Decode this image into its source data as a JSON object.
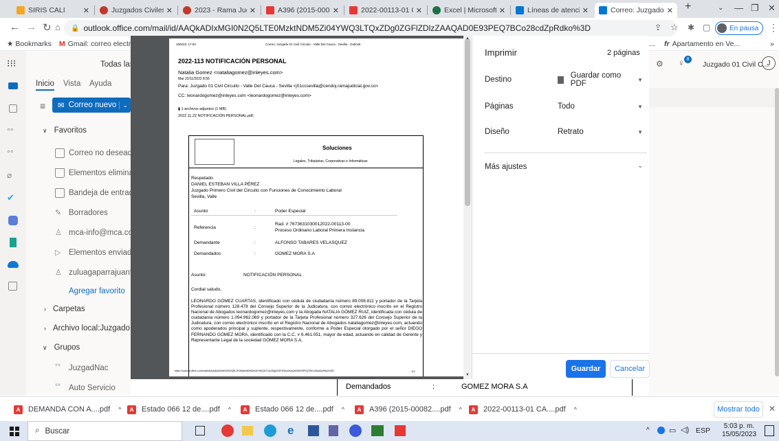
{
  "tabs": [
    {
      "title": "SIRIS CALI",
      "color": "#f5a623"
    },
    {
      "title": "Juzgados Civiles de",
      "color": "#c0392b"
    },
    {
      "title": "2023 - Rama Judic",
      "color": "#c0392b"
    },
    {
      "title": "A396 (2015-00082",
      "color": "#e53935"
    },
    {
      "title": "2022-00113-01 CA",
      "color": "#e53935"
    },
    {
      "title": "Excel | Microsoft 3",
      "color": "#1e7145"
    },
    {
      "title": "Líneas de atención",
      "color": "#0078d4"
    },
    {
      "title": "Correo: Juzgado 01",
      "color": "#0078d4"
    }
  ],
  "browser": {
    "url": "outlook.office.com/mail/id/AAQkADIxMGI0N2Q5LTE0MzktNDM5Zi04YWQ3LTQxZDg0ZGFlZDlzZAAQAD0E93PEQ7BCo28cdZpRdko%3D",
    "bookmarks_label": "Bookmarks",
    "gmail_bookmark": "Gmail: correo electr...",
    "apartamento_bookmark": "Apartamento en Ve...",
    "profile_status": "En pausa",
    "more_bookmarks": "»"
  },
  "outlook": {
    "todas": "Todas las",
    "tabs": [
      "Inicio",
      "Vista",
      "Ayuda"
    ],
    "new_mail": "Correo nuevo",
    "favoritos": "Favoritos",
    "folders": [
      "Correo no deseado",
      "Elementos eliminado",
      "Bandeja de entrada",
      "Borradores",
      "mca-info@mca.com.",
      "Elementos enviados",
      "zuluagaparrajuanfeli"
    ],
    "add_favorite": "Agregar favorito",
    "carpetas": "Carpetas",
    "archivo": "Archivo local:Juzgado 01",
    "grupos": "Grupos",
    "groups": [
      "JuzgadNac",
      "Auto Servicio"
    ],
    "account": "Juzgado 01 Civil C...",
    "account_initial": "J",
    "notif_count": "8",
    "bg_demandados": "Demandados",
    "bg_colon": ":",
    "bg_gomez": "GOMEZ MORA S.A"
  },
  "print": {
    "title": "Imprimir",
    "pages": "2 páginas",
    "destino_label": "Destino",
    "destino_value": "Guardar como PDF",
    "paginas_label": "Páginas",
    "paginas_value": "Todo",
    "diseno_label": "Diseño",
    "diseno_value": "Retrato",
    "mas_ajustes": "Más ajustes",
    "save": "Guardar",
    "cancel": "Cancelar"
  },
  "doc": {
    "header_date": "15/5/23, 17:03",
    "header_title": "Correo: Juzgado 01 Civil Circuito - Valle Del Cauca - Sevilla - Outlook",
    "subject": "2022-113 NOTIFICACIÓN PERSONAL",
    "from": "Natalia Gomez <nataliagomez@inleyes.com>",
    "date": "Mar 22/11/2022 8:55",
    "to": "Para: Juzgado 01 Civil Circuito - Valle Del Cauca - Sevilla <j01ccsevilla@cendoj.ramajudicial.gov.co>",
    "cc": "CC: leonardogomez@inleyes.com <leonardogomez@inleyes.com>",
    "attachments": "1 archivos adjuntos (1 MB)",
    "attachment_name": "2022.11.22 NOTIFICACIÓN PERSONAL.pdf;",
    "company": "Soluciones",
    "company_sub": "Legales, Tributarias, Corporativas e Informáticas",
    "respetado": "Respetado",
    "judge_name": "DANIEL ESTEBAN VILLA PÉREZ",
    "court": "Juzgado Primero Civil del Circuito con Funciones de Conocimiento Laboral",
    "city": "Sevilla, Valle",
    "rows": [
      {
        "k": "Asunto",
        "v": "Poder Especial",
        "v2": ""
      },
      {
        "k": "Referencia",
        "v": "Rad. # 7673631030012022-00113-00",
        "v2": "Proceso Ordinario Laboral Primera Instancia"
      },
      {
        "k": "Demandante",
        "v": "ALFONSO TABARES VELASQUEZ",
        "v2": ""
      },
      {
        "k": "Demandados",
        "v": "GOMEZ MORA S.A",
        "v2": ""
      }
    ],
    "colon": ":",
    "asunto_label": "Asunto:",
    "asunto_value": "NOTIFICACIÓN PERSONAL",
    "greeting": "Cordial saludo,",
    "body": "LEONARDO GÓMEZ CUARTAS, identificado con cédula de ciudadanía número 89.008.811 y portador de la Tarjeta Profesional número 128.478 del Consejo Superior de la Judicatura, con correo electrónico inscrito en el Registro Nacional de Abogados leonardogomez@inleyes.com y la Abogada NATALIA GÓMEZ RUIZ, identificada con cédula de ciudadanía número 1.094.962.069 y portador de la Tarjeta Profesional número 327.626 del Consejo Superior de la Judicatura, con correo electrónico inscrito en el Registro Nacional de Abogados nataliagomez@inleyes.com, actuando como apoderados principal y suplente, respectivamente, conforme a Poder Especial otorgado por el señor DIEGO FERNANDO GÓMEZ MORA, identificado con la C.C. # 6.461.051, mayor de edad, actuando en calidad de Gerente y Representante Legal de la sociedad GÓMEZ MORA S.A,",
    "footer_url": "https://outlook.office.com/mail/id/AAQkADIxMGI0N2Q5LTE0MzktNDM5Zi04YWQ3LTQxZDg0ZGFlZDlzZAAQAD0E93PEQ7BCo28cdZpRdko%3D",
    "footer_page": "1/2"
  },
  "downloads": {
    "items": [
      "DEMANDA CON A....pdf",
      "Estado 066 12 de....pdf",
      "Estado 066 12 de....pdf",
      "A396 (2015-00082....pdf",
      "2022-00113-01 CA....pdf"
    ],
    "show_all": "Mostrar todo"
  },
  "taskbar": {
    "search": "Buscar",
    "lang": "ESP",
    "time": "5:03 p. m.",
    "date": "15/05/2023"
  }
}
